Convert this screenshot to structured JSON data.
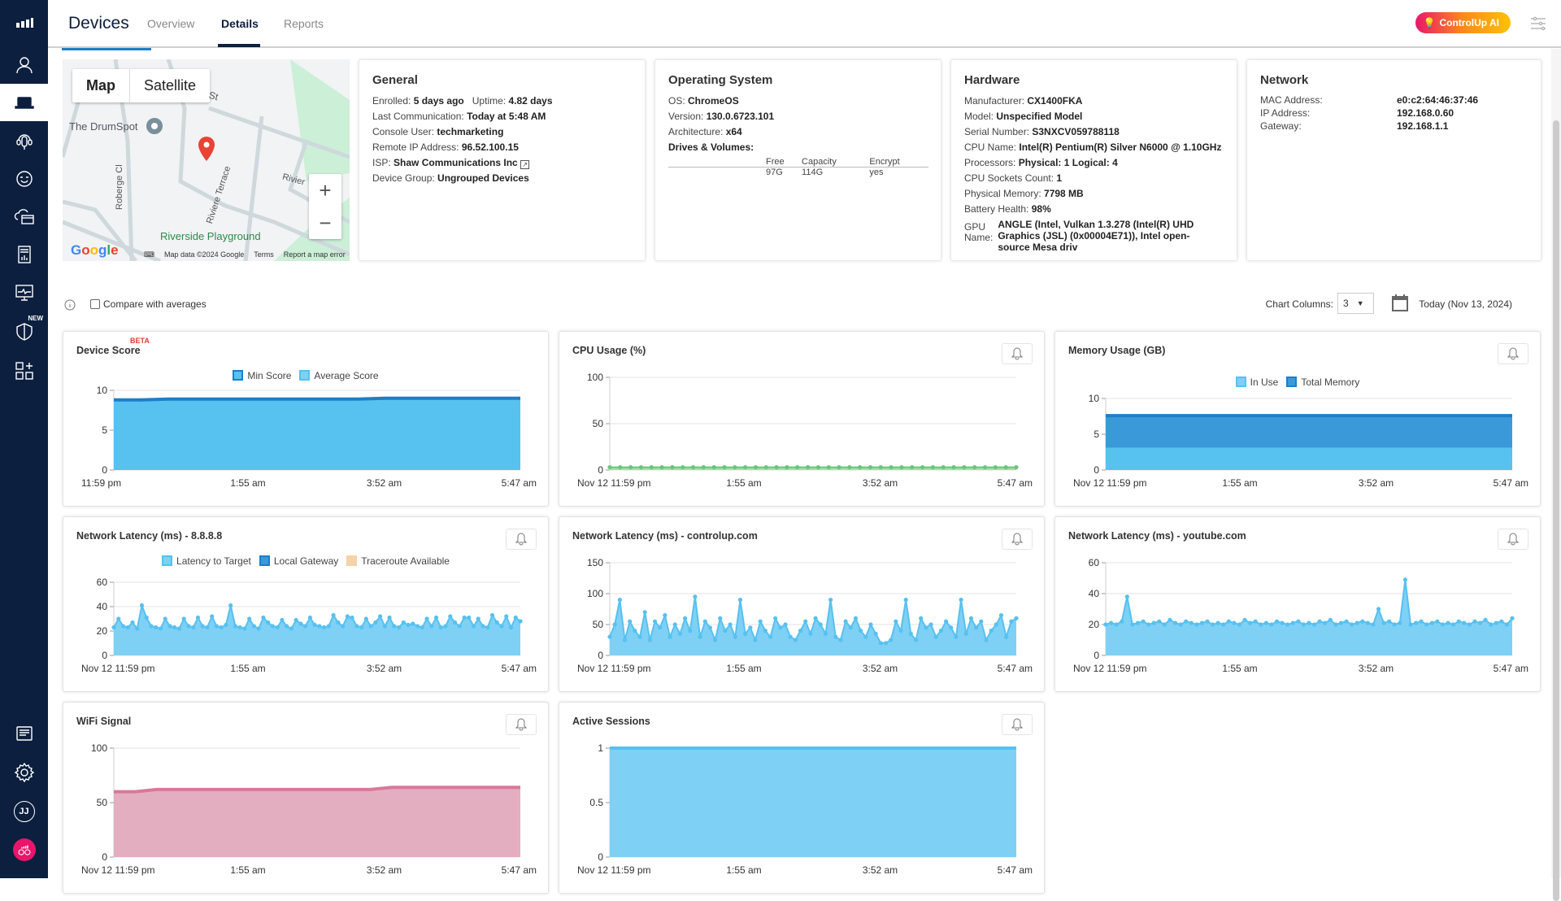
{
  "topbar": {
    "title": "Devices",
    "tabs": [
      "Overview",
      "Details",
      "Reports"
    ],
    "active_tab": "Details",
    "ai_button": "ControlUp AI"
  },
  "sidebar": {
    "items": [
      "logo",
      "users",
      "devices",
      "support",
      "experience",
      "cloud",
      "reports",
      "monitoring",
      "security",
      "integrations",
      "logs",
      "settings",
      "profile",
      "controlup"
    ],
    "new_badge": "NEW",
    "avatar_initials": "JJ"
  },
  "map": {
    "toggle": [
      "Map",
      "Satellite"
    ],
    "labels": [
      "The DrumSpot",
      "Riverside Playground",
      "Riviere Terrace",
      "Roberge Cl",
      "Rivier",
      "St"
    ],
    "zoom_in": "+",
    "zoom_out": "−",
    "google": "Google",
    "footer": [
      "Map data ©2024 Google",
      "Terms",
      "Report a map error"
    ]
  },
  "general": {
    "title": "General",
    "enrolled_label": "Enrolled:",
    "enrolled": "5 days ago",
    "uptime_label": "Uptime:",
    "uptime": "4.82 days",
    "last_comm_label": "Last Communication:",
    "last_comm": "Today at 5:48 AM",
    "console_user_label": "Console User:",
    "console_user": "techmarketing",
    "remote_ip_label": "Remote IP Address:",
    "remote_ip": "96.52.100.15",
    "isp_label": "ISP:",
    "isp": "Shaw Communications Inc",
    "device_group_label": "Device Group:",
    "device_group": "Ungrouped Devices"
  },
  "os": {
    "title": "Operating System",
    "os_label": "OS:",
    "os": "ChromeOS",
    "version_label": "Version:",
    "version": "130.0.6723.101",
    "arch_label": "Architecture:",
    "arch": "x64",
    "drives_label": "Drives & Volumes:",
    "drives_headers": [
      "Free",
      "Capacity",
      "Encrypt"
    ],
    "drives_rows": [
      [
        "97G",
        "114G",
        "yes"
      ]
    ]
  },
  "hardware": {
    "title": "Hardware",
    "rows": [
      {
        "label": "Manufacturer:",
        "value": "CX1400FKA"
      },
      {
        "label": "Model:",
        "value": "Unspecified Model"
      },
      {
        "label": "Serial Number:",
        "value": "S3NXCV059788118"
      },
      {
        "label": "CPU Name:",
        "value": "Intel(R) Pentium(R) Silver N6000 @ 1.10GHz"
      },
      {
        "label": "Processors:",
        "value": "Physical: 1  Logical: 4"
      },
      {
        "label": "CPU Sockets Count:",
        "value": "1"
      },
      {
        "label": "Physical Memory:",
        "value": "7798 MB"
      },
      {
        "label": "Battery Health:",
        "value": "98%"
      }
    ],
    "gpu_label_1": "GPU",
    "gpu_label_2": "Name:",
    "gpu_value": "ANGLE (Intel, Vulkan 1.3.278 (Intel(R) UHD Graphics (JSL) (0x00004E71)), Intel open-source Mesa driv"
  },
  "network": {
    "title": "Network",
    "rows": [
      {
        "label": "MAC Address:",
        "value": "e0:c2:64:46:37:46"
      },
      {
        "label": "IP Address:",
        "value": "192.168.0.60"
      },
      {
        "label": "Gateway:",
        "value": "192.168.1.1"
      }
    ]
  },
  "controls": {
    "compare_label": "Compare with averages",
    "compare_checked": false,
    "chart_columns_label": "Chart Columns:",
    "chart_columns_value": "3",
    "date_label": "Today (Nov 13, 2024)"
  },
  "colors": {
    "light_blue": "#7fd0f5",
    "mid_blue": "#57c1f0",
    "dark_blue": "#1e7ec8",
    "green": "#6cc47a",
    "pink": "#e4aec1",
    "pink_line": "#d9789a",
    "trace": "#f3d3a9"
  },
  "chart_data": [
    {
      "id": "device-score",
      "type": "area",
      "title": "Device Score",
      "beta": "BETA",
      "bell": false,
      "x_ticks": [
        "11:59 pm",
        "1:55 am",
        "3:52 am",
        "5:47 am"
      ],
      "ylim": [
        0,
        10
      ],
      "y_ticks": [
        0,
        5,
        10
      ],
      "legend": [
        {
          "name": "Min Score",
          "color": "#57c1f0",
          "border": "#1e7ec8"
        },
        {
          "name": "Average Score",
          "color": "#7fd0f5",
          "border": "#57c1f0"
        }
      ],
      "series": [
        {
          "name": "Min Score",
          "values": [
            8.8,
            8.8,
            8.9,
            8.9,
            8.9,
            8.9,
            8.9,
            8.9,
            8.9,
            8.9,
            9.0,
            9.0,
            9.0,
            9.0,
            9.0,
            9.0
          ],
          "fill": "#57c1f0",
          "line": "#1e7ec8"
        }
      ]
    },
    {
      "id": "cpu-usage",
      "type": "line",
      "title": "CPU Usage (%)",
      "bell": true,
      "x_ticks": [
        "Nov 12 11:59 pm",
        "1:55 am",
        "3:52 am",
        "5:47 am"
      ],
      "ylim": [
        0,
        100
      ],
      "y_ticks": [
        0,
        50,
        100
      ],
      "legend": [],
      "series": [
        {
          "name": "CPU",
          "values": [
            3,
            3,
            3,
            3,
            3,
            3,
            3,
            3,
            3,
            3,
            3,
            3,
            3,
            3,
            3,
            3,
            3,
            3,
            3,
            3,
            3,
            3,
            3,
            3,
            3,
            3,
            3,
            3,
            3,
            3,
            3,
            3,
            3,
            3,
            3,
            3,
            3,
            3,
            3,
            3
          ],
          "fill": "#a7dcae",
          "line": "#6cc47a",
          "dots": true
        }
      ]
    },
    {
      "id": "memory-usage",
      "type": "area",
      "title": "Memory Usage (GB)",
      "bell": true,
      "x_ticks": [
        "Nov 12 11:59 pm",
        "1:55 am",
        "3:52 am",
        "5:47 am"
      ],
      "ylim": [
        0,
        10
      ],
      "y_ticks": [
        0,
        5,
        10
      ],
      "legend": [
        {
          "name": "In Use",
          "color": "#7fd0f5",
          "border": "#57c1f0"
        },
        {
          "name": "Total Memory",
          "color": "#3a9ad9",
          "border": "#1e7ec8"
        }
      ],
      "series": [
        {
          "name": "Total Memory",
          "values": [
            7.6,
            7.6,
            7.6,
            7.6,
            7.6,
            7.6
          ],
          "fill": "#3a9ad9",
          "line": "#1e7ec8"
        },
        {
          "name": "In Use",
          "values": [
            2.9,
            2.9,
            2.9,
            2.9,
            2.9,
            2.9
          ],
          "fill": "#57c1f0",
          "line": "#57c1f0"
        }
      ]
    },
    {
      "id": "latency-8888",
      "type": "area",
      "title": "Network Latency (ms) - 8.8.8.8",
      "bell": true,
      "x_ticks": [
        "Nov 12 11:59 pm",
        "1:55 am",
        "3:52 am",
        "5:47 am"
      ],
      "ylim": [
        0,
        60
      ],
      "y_ticks": [
        0,
        20,
        40,
        60
      ],
      "legend": [
        {
          "name": "Latency to Target",
          "color": "#7fd0f5",
          "border": "#57c1f0"
        },
        {
          "name": "Local Gateway",
          "color": "#3a9ad9",
          "border": "#1e7ec8"
        },
        {
          "name": "Traceroute Available",
          "color": "#f3d3a9",
          "border": "#f3d3a9"
        }
      ],
      "series": [
        {
          "name": "Latency to Target",
          "values": [
            23,
            30,
            24,
            23,
            27,
            22,
            41,
            31,
            24,
            23,
            22,
            30,
            24,
            23,
            22,
            30,
            24,
            23,
            31,
            24,
            23,
            32,
            24,
            23,
            25,
            41,
            24,
            23,
            22,
            30,
            24,
            22,
            31,
            27,
            24,
            23,
            29,
            24,
            22,
            29,
            26,
            24,
            31,
            25,
            24,
            23,
            24,
            33,
            27,
            24,
            32,
            31,
            24,
            23,
            30,
            24,
            27,
            32,
            24,
            31,
            24,
            23,
            27,
            25,
            26,
            24,
            23,
            30,
            24,
            31,
            23,
            24,
            32,
            27,
            24,
            31,
            31,
            24,
            30,
            24,
            23,
            33,
            27,
            24,
            32,
            23,
            31,
            28
          ],
          "fill": "#7fd0f5",
          "line": "#57c1f0",
          "dots": true
        }
      ]
    },
    {
      "id": "latency-controlup",
      "type": "area",
      "title": "Network Latency (ms) - controlup.com",
      "bell": true,
      "x_ticks": [
        "Nov 12 11:59 pm",
        "1:55 am",
        "3:52 am",
        "5:47 am"
      ],
      "ylim": [
        0,
        150
      ],
      "y_ticks": [
        0,
        50,
        100,
        150
      ],
      "legend": [],
      "series": [
        {
          "name": "Latency",
          "values": [
            30,
            50,
            90,
            25,
            55,
            40,
            30,
            70,
            25,
            55,
            45,
            65,
            30,
            50,
            35,
            60,
            40,
            95,
            30,
            55,
            45,
            25,
            60,
            40,
            50,
            30,
            90,
            35,
            45,
            25,
            55,
            40,
            30,
            60,
            45,
            50,
            30,
            25,
            40,
            55,
            35,
            60,
            50,
            35,
            90,
            30,
            25,
            55,
            45,
            60,
            40,
            30,
            50,
            35,
            20,
            20,
            25,
            55,
            40,
            90,
            35,
            25,
            60,
            45,
            50,
            30,
            40,
            55,
            45,
            30,
            90,
            35,
            60,
            45,
            55,
            25,
            40,
            50,
            65,
            30,
            55,
            60
          ],
          "fill": "#7fd0f5",
          "line": "#57c1f0",
          "dots": true
        }
      ]
    },
    {
      "id": "latency-youtube",
      "type": "area",
      "title": "Network Latency (ms) - youtube.com",
      "bell": true,
      "x_ticks": [
        "Nov 12 11:59 pm",
        "1:55 am",
        "3:52 am",
        "5:47 am"
      ],
      "ylim": [
        0,
        60
      ],
      "y_ticks": [
        0,
        20,
        40,
        60
      ],
      "legend": [],
      "series": [
        {
          "name": "Latency",
          "values": [
            20,
            21,
            20,
            22,
            38,
            20,
            21,
            22,
            20,
            21,
            22,
            20,
            23,
            21,
            20,
            22,
            21,
            20,
            21,
            22,
            20,
            21,
            20,
            22,
            21,
            20,
            23,
            21,
            22,
            20,
            21,
            20,
            22,
            21,
            20,
            21,
            22,
            20,
            21,
            20,
            22,
            21,
            23,
            20,
            21,
            22,
            20,
            21,
            22,
            21,
            20,
            30,
            21,
            22,
            20,
            21,
            49,
            20,
            21,
            22,
            20,
            21,
            22,
            20,
            21,
            20,
            22,
            21,
            20,
            22,
            21,
            23,
            20,
            21,
            22,
            20,
            24
          ],
          "fill": "#7fd0f5",
          "line": "#57c1f0",
          "dots": true
        }
      ]
    },
    {
      "id": "wifi-signal",
      "type": "area",
      "title": "WiFi Signal",
      "bell": true,
      "x_ticks": [
        "Nov 12 11:59 pm",
        "1:55 am",
        "3:52 am",
        "5:47 am"
      ],
      "ylim": [
        0,
        100
      ],
      "y_ticks": [
        0,
        50,
        100
      ],
      "legend": [],
      "series": [
        {
          "name": "WiFi",
          "values": [
            60,
            60,
            62,
            62,
            62,
            62,
            62,
            62,
            62,
            62,
            62,
            62,
            62,
            64,
            64,
            64,
            64,
            64,
            64,
            64
          ],
          "fill": "#e4aec1",
          "line": "#d9789a"
        }
      ]
    },
    {
      "id": "active-sessions",
      "type": "area",
      "title": "Active Sessions",
      "bell": true,
      "x_ticks": [
        "Nov 12 11:59 pm",
        "1:55 am",
        "3:52 am",
        "5:47 am"
      ],
      "ylim": [
        0,
        1
      ],
      "y_ticks": [
        0,
        0.5,
        1
      ],
      "legend": [],
      "series": [
        {
          "name": "Sessions",
          "values": [
            1,
            1,
            1,
            1,
            1,
            1
          ],
          "fill": "#7fd0f5",
          "line": "#57c1f0"
        }
      ]
    }
  ]
}
